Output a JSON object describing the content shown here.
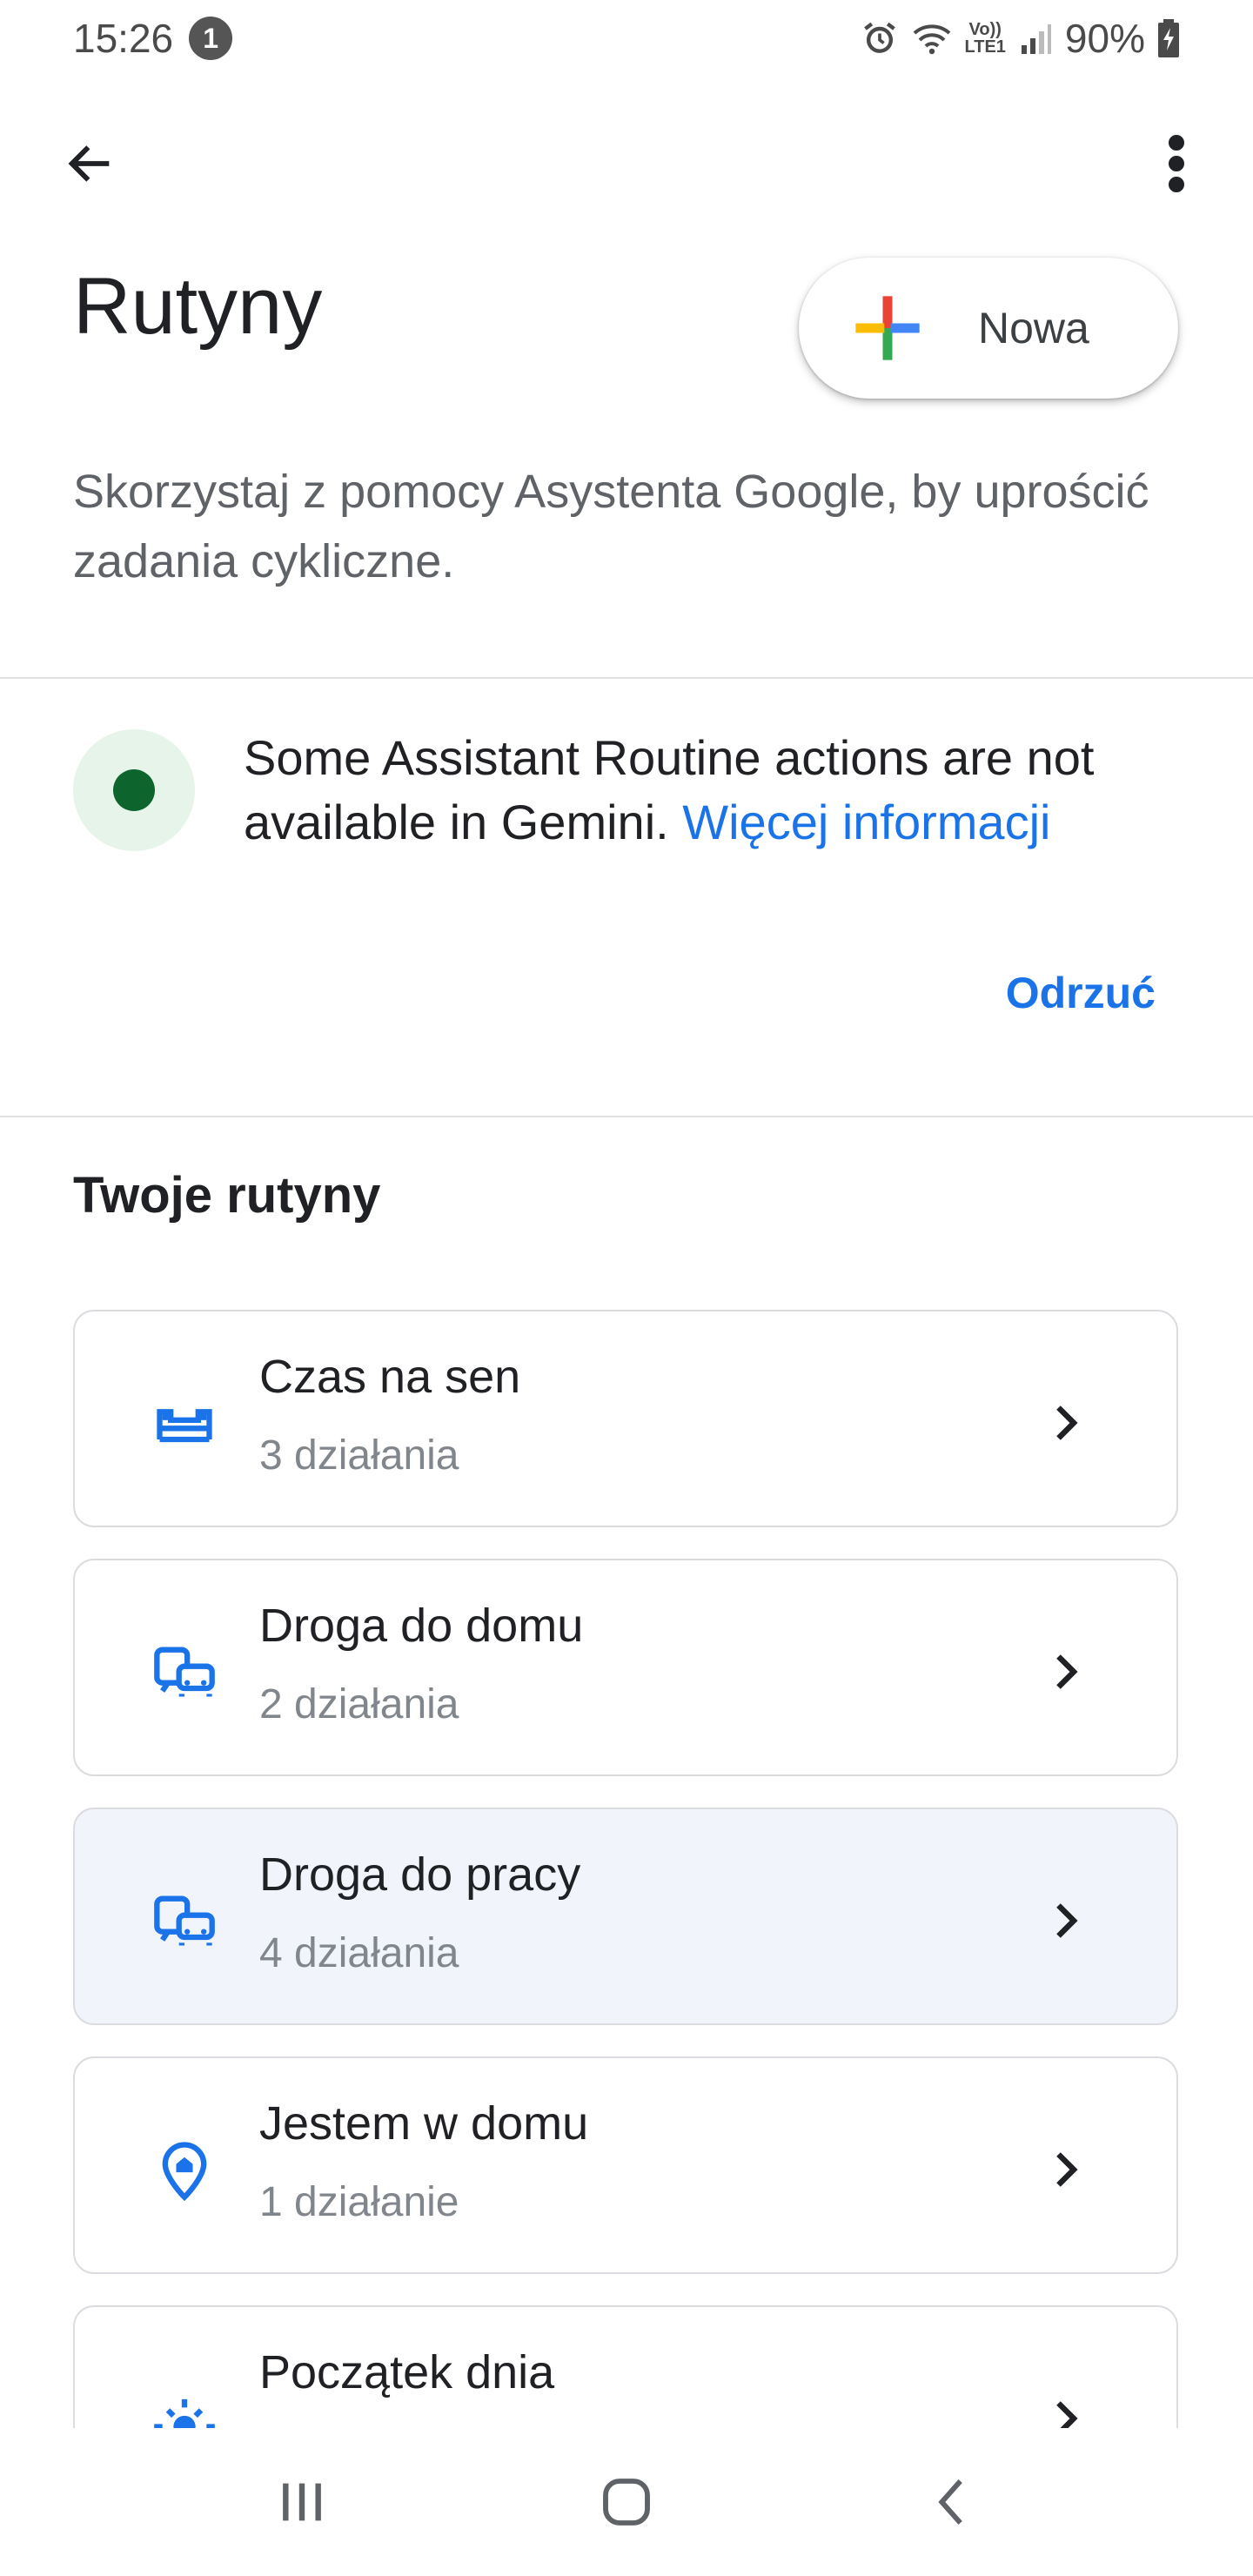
{
  "status_bar": {
    "time": "15:26",
    "notification_count": "1",
    "network_label_top": "Vo))",
    "network_label_bottom": "LTE1",
    "battery": "90%"
  },
  "header": {
    "title": "Rutyny",
    "new_button_label": "Nowa",
    "subtitle": "Skorzystaj z pomocy Asystenta Google, by uprościć zadania cykliczne."
  },
  "banner": {
    "text": "Some Assistant Routine actions are not available in Gemini.",
    "link": "Więcej informacji",
    "dismiss": "Odrzuć"
  },
  "routines_section": {
    "title": "Twoje rutyny",
    "items": [
      {
        "name": "Czas na sen",
        "count": "3 działania",
        "icon": "bed-icon"
      },
      {
        "name": "Droga do domu",
        "count": "2 działania",
        "icon": "commute-icon"
      },
      {
        "name": "Droga do pracy",
        "count": "4 działania",
        "icon": "commute-icon"
      },
      {
        "name": "Jestem w domu",
        "count": "1 działanie",
        "icon": "home-location-icon"
      },
      {
        "name": "Początek dnia",
        "count": "",
        "icon": "sunrise-icon"
      }
    ]
  },
  "colors": {
    "accent_blue": "#1a73e8",
    "banner_green": "#0d652d",
    "banner_bg": "#e6f4ea"
  }
}
